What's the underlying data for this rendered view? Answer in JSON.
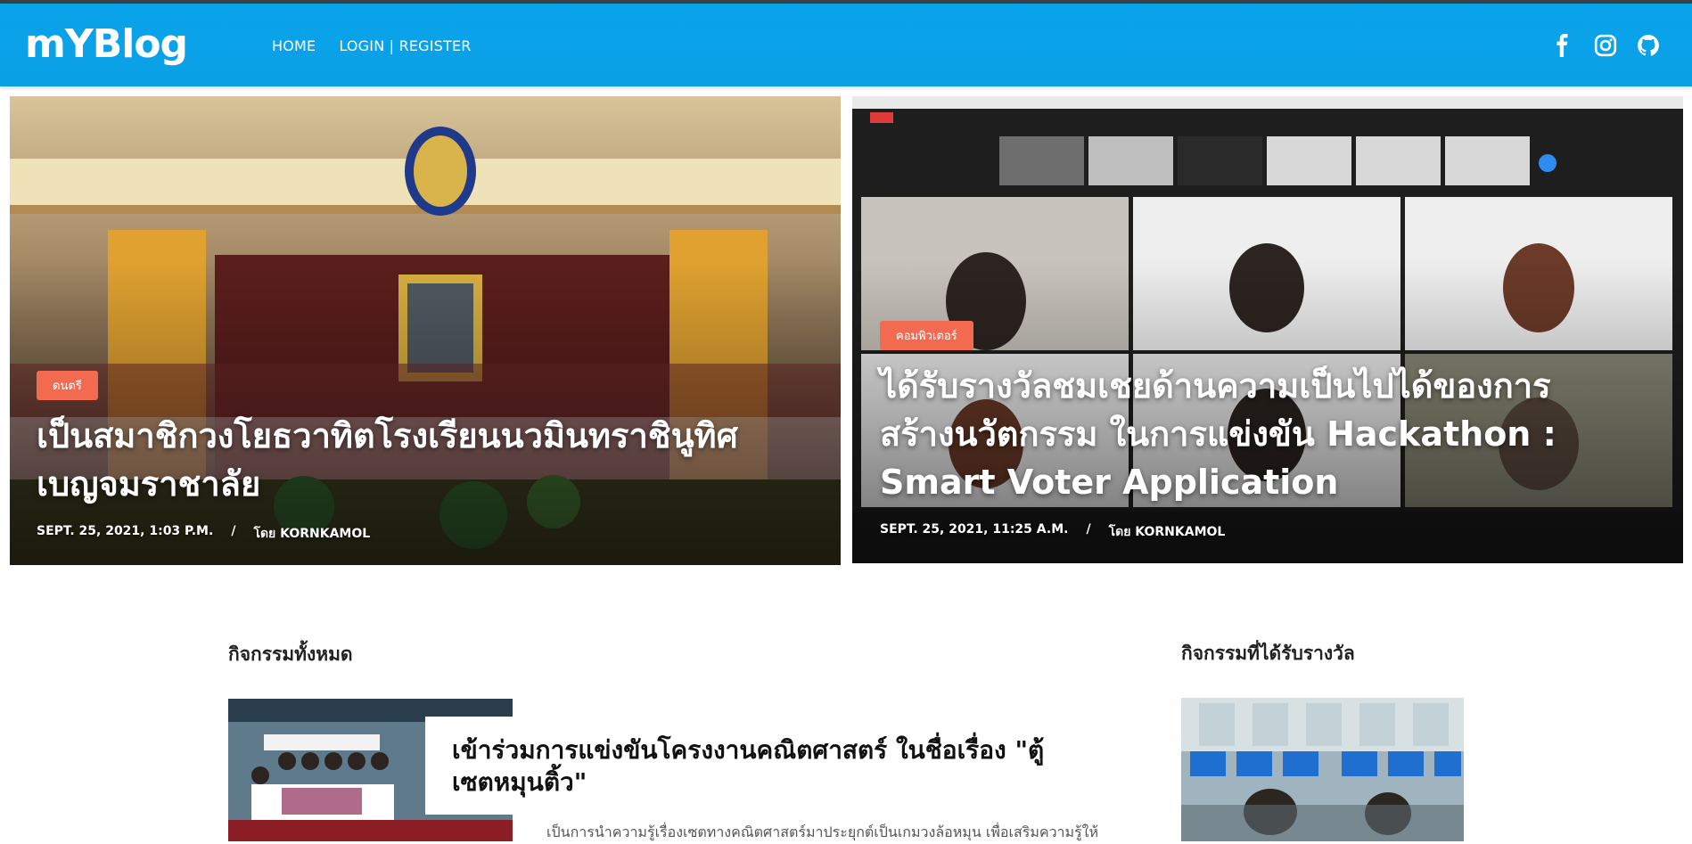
{
  "brand": {
    "logo": "mYBlog"
  },
  "nav": {
    "home": "HOME",
    "login_register": "LOGIN | REGISTER"
  },
  "social": [
    "facebook-icon",
    "instagram-icon",
    "github-icon"
  ],
  "colors": {
    "header": "#09a3ea",
    "badge": "#f26a4f"
  },
  "featured": [
    {
      "category": "ดนตรี",
      "title_line1": "เป็นสมาชิกวงโยธวาทิตโรงเรียนนวมินทราชินูทิศ",
      "title_line2": "เบญจมราชาลัย",
      "date": "SEPT. 25, 2021, 1:03 P.M.",
      "separator": "/",
      "author": "โดย KORNKAMOL"
    },
    {
      "category": "คอมพิวเตอร์",
      "title_line1": "ได้รับรางวัลชมเชยด้านความเป็นไปได้ของการ",
      "title_line2": "สร้างนวัตกรรม ในการแข่งขัน Hackathon :",
      "title_line3": "Smart Voter Application",
      "date": "SEPT. 25, 2021, 11:25 A.M.",
      "separator": "/",
      "author": "โดย KORNKAMOL"
    }
  ],
  "sections": {
    "all_activities": "กิจกรรมทั้งหมด",
    "awarded_activities": "กิจกรรมที่ได้รับรางวัล"
  },
  "latest_post": {
    "title_line1": "เข้าร่วมการแข่งขันโครงงานคณิตศาสตร์ ในชื่อเรื่อง \"ตู้",
    "title_line2": "เซตหมุนติ้ว\"",
    "excerpt": "เป็นการนำความรู้เรื่องเซตทางคณิตศาสตร์มาประยุกต์เป็นเกมวงล้อหมุน เพื่อเสริมความรู้ให้"
  }
}
